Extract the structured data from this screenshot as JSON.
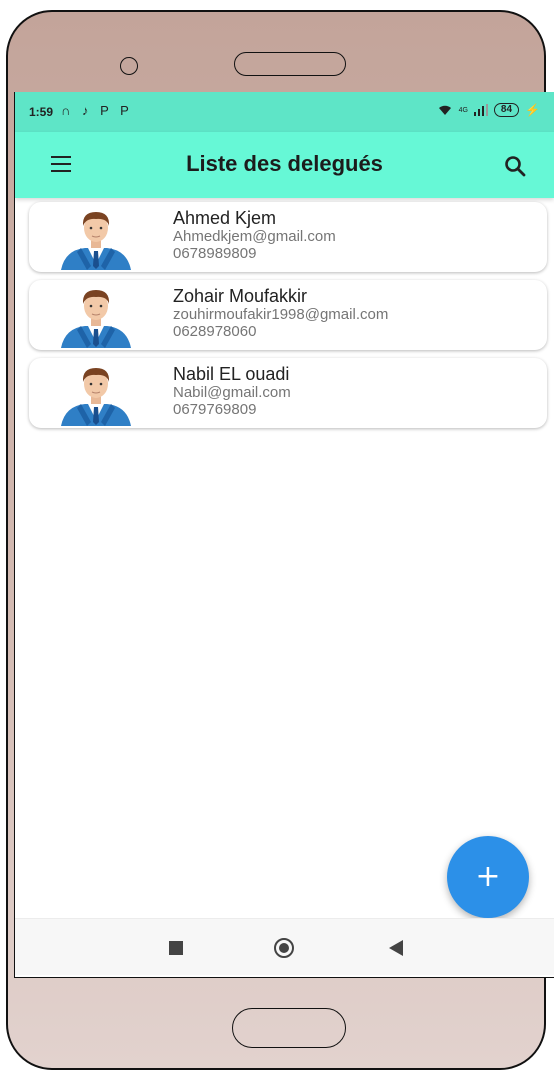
{
  "status_bar": {
    "time": "1:59",
    "left_icons": "∩ ♪ P P",
    "network": "4G",
    "battery": "84",
    "charging": "⚡"
  },
  "header": {
    "title": "Liste des delegués",
    "menu_icon": "menu-icon",
    "search_icon": "search-icon"
  },
  "delegates": [
    {
      "name": "Ahmed Kjem",
      "email": "Ahmedkjem@gmail.com",
      "phone": "0678989809"
    },
    {
      "name": "Zohair Moufakkir",
      "email": "zouhirmoufakir1998@gmail.com",
      "phone": "0628978060"
    },
    {
      "name": "Nabil EL ouadi",
      "email": "Nabil@gmail.com",
      "phone": "0679769809"
    }
  ],
  "fab": {
    "label": "+"
  },
  "colors": {
    "appbar": "#66f8d6",
    "status_bar": "#5ee5c7",
    "fab": "#2c90e8"
  }
}
